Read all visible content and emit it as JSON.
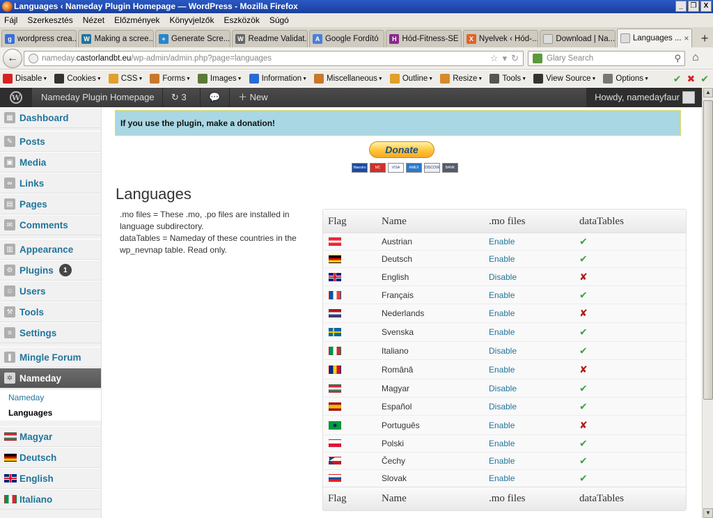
{
  "window": {
    "title": "Languages ‹ Nameday Plugin Homepage — WordPress - Mozilla Firefox",
    "buttons": [
      "_",
      "❐",
      "X"
    ]
  },
  "menubar": [
    "Fájl",
    "Szerkesztés",
    "Nézet",
    "Előzmények",
    "Könyvjelzők",
    "Eszközök",
    "Súgó"
  ],
  "tabs": [
    {
      "label": "wordpress crea...",
      "icon": "google-icon",
      "color": "#3b6fd6",
      "glyph": "g"
    },
    {
      "label": "Making a scree...",
      "icon": "wordpress-icon",
      "color": "#21759b",
      "glyph": "W"
    },
    {
      "label": "Generate Scre...",
      "icon": "plugin-icon",
      "color": "#2a86c8",
      "glyph": "+"
    },
    {
      "label": "Readme Validat...",
      "icon": "wordpress-icon",
      "color": "#666666",
      "glyph": "W"
    },
    {
      "label": "Google Fordító",
      "icon": "translate-icon",
      "color": "#4a7fd6",
      "glyph": "A"
    },
    {
      "label": "Hód-Fitness-SE",
      "icon": "fitness-icon",
      "color": "#8a2a8a",
      "glyph": "H"
    },
    {
      "label": "Nyelvek ‹ Hód-...",
      "icon": "x-site-icon",
      "color": "#e0632a",
      "glyph": "X"
    },
    {
      "label": "Download | Na...",
      "icon": "page-icon",
      "color": "#dddddd",
      "glyph": ""
    },
    {
      "label": "Languages ...",
      "icon": "page-icon",
      "color": "#dddddd",
      "glyph": "",
      "active": true
    }
  ],
  "nav": {
    "url_prefix": "nameday.",
    "url_domain": "castorlandbt.eu",
    "url_path": "/wp-admin/admin.php?page=languages",
    "search_placeholder": "Glary Search"
  },
  "devbar": [
    {
      "label": "Disable",
      "color": "#d62222"
    },
    {
      "label": "Cookies",
      "color": "#333333"
    },
    {
      "label": "CSS",
      "color": "#e0a02a"
    },
    {
      "label": "Forms",
      "color": "#c8782a"
    },
    {
      "label": "Images",
      "color": "#5a7a3a"
    },
    {
      "label": "Information",
      "color": "#2a6ad6"
    },
    {
      "label": "Miscellaneous",
      "color": "#c8782a"
    },
    {
      "label": "Outline",
      "color": "#e0a02a"
    },
    {
      "label": "Resize",
      "color": "#d68a2a"
    },
    {
      "label": "Tools",
      "color": "#555555"
    },
    {
      "label": "View Source",
      "color": "#333333"
    },
    {
      "label": "Options",
      "color": "#777777"
    }
  ],
  "adminbar": {
    "site": "Nameday Plugin Homepage",
    "updates": "3",
    "new": "New",
    "howdy": "Howdy, namedayfaur"
  },
  "sidebar": {
    "items": [
      {
        "label": "Dashboard",
        "icon": "dashboard-icon"
      },
      {
        "label": "Posts",
        "icon": "posts-icon"
      },
      {
        "label": "Media",
        "icon": "media-icon"
      },
      {
        "label": "Links",
        "icon": "links-icon"
      },
      {
        "label": "Pages",
        "icon": "pages-icon"
      },
      {
        "label": "Comments",
        "icon": "comments-icon"
      },
      {
        "label": "Appearance",
        "icon": "appearance-icon"
      },
      {
        "label": "Plugins",
        "icon": "plugins-icon",
        "badge": "1"
      },
      {
        "label": "Users",
        "icon": "users-icon"
      },
      {
        "label": "Tools",
        "icon": "tools-icon"
      },
      {
        "label": "Settings",
        "icon": "settings-icon"
      },
      {
        "label": "Mingle Forum",
        "icon": "forum-icon"
      },
      {
        "label": "Nameday",
        "icon": "gear-icon",
        "current": true
      }
    ],
    "submenu": [
      "Nameday",
      "Languages"
    ],
    "lang_items": [
      {
        "label": "Magyar",
        "flag": "hu"
      },
      {
        "label": "Deutsch",
        "flag": "de"
      },
      {
        "label": "English",
        "flag": "gb"
      },
      {
        "label": "Italiano",
        "flag": "it"
      }
    ]
  },
  "main": {
    "notice": "If you use the plugin, make a donation!",
    "donate_label": "Donate",
    "cards": [
      {
        "label": "Maestro",
        "color": "#1a4aa6"
      },
      {
        "label": "MC",
        "color": "#d0302a"
      },
      {
        "label": "VISA",
        "color": "#ffffff"
      },
      {
        "label": "AMEX",
        "color": "#2a7ac8"
      },
      {
        "label": "DISCOVER",
        "color": "#f0f0f0"
      },
      {
        "label": "BANK",
        "color": "#555a6a"
      }
    ],
    "title": "Languages",
    "desc": [
      ".mo files = These .mo, .po files are installed in language subdirectory.",
      "dataTables = Nameday of these countries in the wp_nevnap table. Read only."
    ],
    "columns": [
      "Flag",
      "Name",
      ".mo files",
      "dataTables"
    ],
    "rows": [
      {
        "flag": "at",
        "name": "Austrian",
        "mo": "Enable",
        "dt": true
      },
      {
        "flag": "de",
        "name": "Deutsch",
        "mo": "Enable",
        "dt": true
      },
      {
        "flag": "gb",
        "name": "English",
        "mo": "Disable",
        "dt": false
      },
      {
        "flag": "fr",
        "name": "Français",
        "mo": "Enable",
        "dt": true
      },
      {
        "flag": "nl",
        "name": "Nederlands",
        "mo": "Enable",
        "dt": false
      },
      {
        "flag": "se",
        "name": "Svenska",
        "mo": "Enable",
        "dt": true
      },
      {
        "flag": "it",
        "name": "Italiano",
        "mo": "Disable",
        "dt": true
      },
      {
        "flag": "ro",
        "name": "Română",
        "mo": "Enable",
        "dt": false
      },
      {
        "flag": "hu",
        "name": "Magyar",
        "mo": "Disable",
        "dt": true
      },
      {
        "flag": "es",
        "name": "Español",
        "mo": "Disable",
        "dt": true
      },
      {
        "flag": "br",
        "name": "Português",
        "mo": "Enable",
        "dt": false
      },
      {
        "flag": "pl",
        "name": "Polski",
        "mo": "Enable",
        "dt": true
      },
      {
        "flag": "cz",
        "name": "Čechy",
        "mo": "Enable",
        "dt": true
      },
      {
        "flag": "sk",
        "name": "Slovak",
        "mo": "Enable",
        "dt": true
      }
    ]
  }
}
